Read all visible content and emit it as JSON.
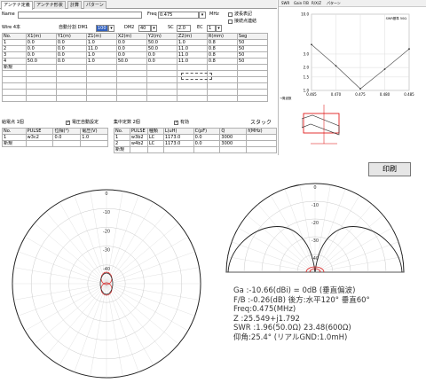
{
  "tabs": [
    "アンテナ定義",
    "アンテナ形状",
    "計算",
    "パターン"
  ],
  "name_label": "Name",
  "freq_label": "Freq",
  "freq_value": "0.475",
  "freq_unit": "MHz",
  "wave_label": "波長表記",
  "connect_label": "接続点連結",
  "wire_label": "Wire 4本",
  "auto_div": "自動分割 DM1",
  "dm1_value": "100",
  "dm2_label": "DM2",
  "dm2_value": "40",
  "sc_label": "SC",
  "sc_value": "2.0",
  "ec_label": "EC",
  "ec_value": "1",
  "wire_headers": [
    "No.",
    "X1(m)",
    "Y1(m)",
    "Z1(m)",
    "X2(m)",
    "Y2(m)",
    "Z2(m)",
    "R(mm)",
    "Seg"
  ],
  "wire_rows": [
    [
      "1",
      "0.0",
      "0.0",
      "1.0",
      "0.0",
      "50.0",
      "1.0",
      "0.8",
      "50"
    ],
    [
      "2",
      "0.0",
      "0.0",
      "11.0",
      "0.0",
      "50.0",
      "11.0",
      "0.8",
      "50"
    ],
    [
      "3",
      "0.0",
      "0.0",
      "1.0",
      "0.0",
      "0.0",
      "11.0",
      "0.8",
      "50"
    ],
    [
      "4",
      "50.0",
      "0.0",
      "1.0",
      "50.0",
      "0.0",
      "11.0",
      "0.8",
      "50"
    ]
  ],
  "new_label": "新規",
  "feed_title": "給電点 1個",
  "voltage_label": "電圧自動設定",
  "feed_headers": [
    "No.",
    "PULSE",
    "位相(°)",
    "電圧(V)"
  ],
  "feed_rows": [
    [
      "1",
      "w3c2",
      "0.0",
      "1.0"
    ]
  ],
  "load_title": "集中定数 2個",
  "valid_label": "有効",
  "stack_label": "スタック",
  "load_headers": [
    "No.",
    "PULSE",
    "種類",
    "L(uH)",
    "C(pF)",
    "Q",
    "f(MHz)"
  ],
  "load_rows": [
    [
      "1",
      "w3b2",
      "LC",
      "1173.0",
      "0.0",
      "3000",
      ""
    ],
    [
      "2",
      "w4b2",
      "LC",
      "1173.0",
      "0.0",
      "3000",
      ""
    ]
  ],
  "print_label": "印刷",
  "swr_tabs": [
    "SWR",
    "Gain F/B",
    "R/X/Z",
    "パターン"
  ],
  "swr_y_ticks": [
    "10.0",
    "3.0",
    "2.0",
    "1.5",
    "1.0"
  ],
  "swr_x_ticks": [
    "0.465",
    "0.470",
    "0.475",
    "0.480",
    "0.485"
  ],
  "swr_box_label": "SWR基準 50Ω",
  "swr_corner_label": "→周波数",
  "swr_data": {
    "freq": [
      0.465,
      0.47,
      0.475,
      0.48,
      0.485
    ],
    "swr": [
      4.0,
      2.1,
      1.05,
      1.9,
      3.5
    ]
  },
  "polar_labels": [
    "0",
    "-10",
    "-20",
    "-30",
    "-40"
  ],
  "results": [
    "Ga  :-10.66(dBi) = 0dB (垂直偏波)",
    "F/B :-0.26(dB) 後方:水平120° 垂直60°",
    "Freq:0.475(MHz)",
    "Z   :25.549+j1.792",
    "SWR :1.96(50.0Ω) 23.48(600Ω)",
    "仰角:25.4° (リアルGND:1.0mH)"
  ]
}
